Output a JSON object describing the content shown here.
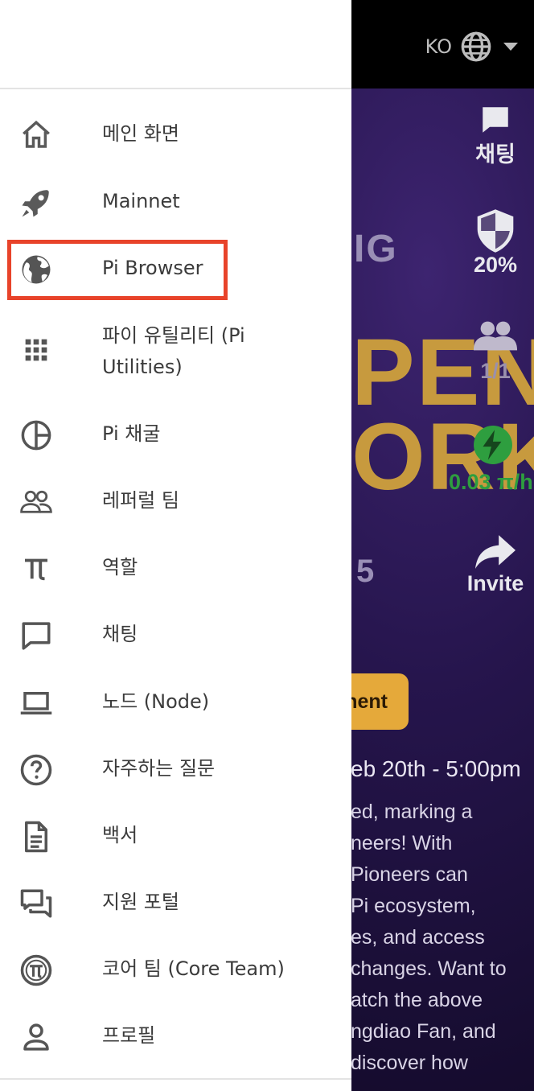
{
  "header": {
    "language": "KO"
  },
  "rail": {
    "chat_label": "채팅",
    "security_value": "20%",
    "team_value": "1/1",
    "mining_rate": "0.03 π/h",
    "invite_label": "Invite"
  },
  "background": {
    "fragment_1": "IG",
    "fragment_2": "PEN",
    "fragment_3": "ORK",
    "fragment_4": "5",
    "button_text": "nent",
    "event_date": "eb 20th - 5:00pm",
    "article_lines": [
      "ed, marking a",
      "neers! With",
      "Pioneers can",
      "Pi ecosystem,",
      "es, and access",
      "changes. Want to",
      "atch the above",
      "ngdiao Fan, and",
      "discover how"
    ]
  },
  "menu": [
    {
      "label": "메인 화면",
      "icon": "home-icon"
    },
    {
      "label": "Mainnet",
      "icon": "rocket-icon"
    },
    {
      "label": "Pi Browser",
      "icon": "globe-icon"
    },
    {
      "label": "파이 유틸리티 (Pi Utilities)",
      "line1": "파이 유틸리티 (Pi",
      "line2": "Utilities)",
      "icon": "apps-grid-icon"
    },
    {
      "label": "Pi 채굴",
      "icon": "pie-chart-icon"
    },
    {
      "label": "레퍼럴 팀",
      "icon": "people-icon"
    },
    {
      "label": "역할",
      "icon": "pi-symbol-icon"
    },
    {
      "label": "채팅",
      "icon": "chat-icon"
    },
    {
      "label": "노드 (Node)",
      "icon": "laptop-icon"
    },
    {
      "label": "자주하는 질문",
      "icon": "help-circle-icon"
    },
    {
      "label": "백서",
      "icon": "document-icon"
    },
    {
      "label": "지원 포털",
      "icon": "forum-icon"
    },
    {
      "label": "코어 팀 (Core Team)",
      "icon": "pi-coin-icon"
    },
    {
      "label": "프로필",
      "icon": "person-icon"
    }
  ],
  "colors": {
    "highlight": "#e8432a",
    "accent_gold": "#e5a93a",
    "mining_green": "#2e9e3f"
  }
}
